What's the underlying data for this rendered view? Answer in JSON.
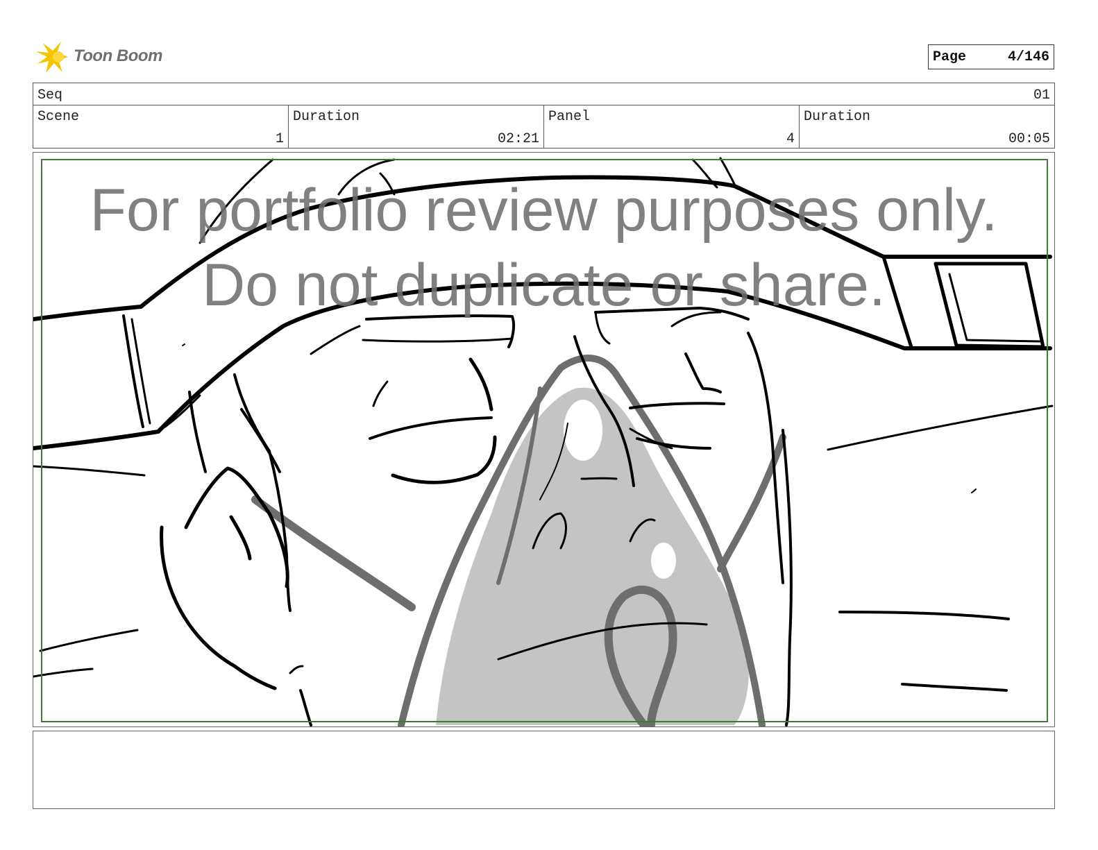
{
  "logo": {
    "text": "Toon Boom",
    "icon": "starburst-icon",
    "icon_color": "#f5c400"
  },
  "page": {
    "label": "Page",
    "value": "4/146"
  },
  "header": {
    "seq_label": "Seq",
    "seq_value": "01",
    "scene_label": "Scene",
    "scene_value": "1",
    "scene_duration_label": "Duration",
    "scene_duration_value": "02:21",
    "panel_label": "Panel",
    "panel_value": "4",
    "panel_duration_label": "Duration",
    "panel_duration_value": "00:05"
  },
  "watermark": {
    "line1": "For portfolio review purposes only.",
    "line2": "Do not duplicate or share."
  },
  "colors": {
    "safe_frame": "#3c7a35",
    "sketch_ink": "#000000",
    "sketch_gray": "#6e6e6e",
    "sketch_fill": "#c4c4c4"
  },
  "notes": ""
}
